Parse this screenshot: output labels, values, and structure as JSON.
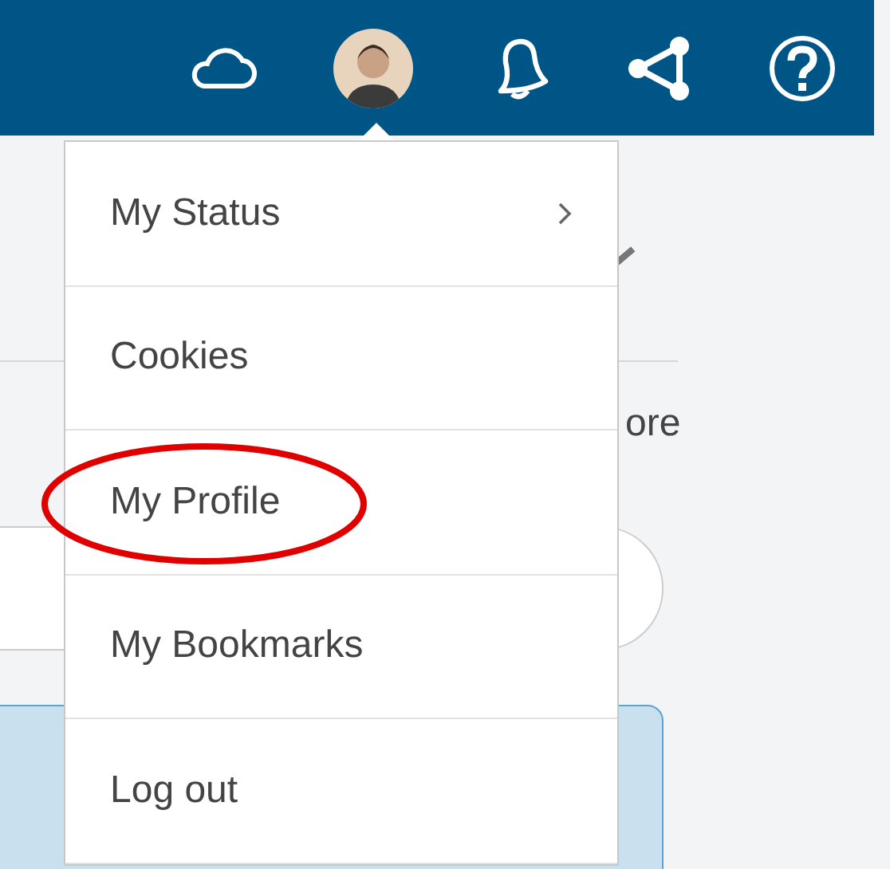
{
  "header": {
    "icons": [
      {
        "kind": "cloud"
      },
      {
        "kind": "avatar"
      },
      {
        "kind": "bell"
      },
      {
        "kind": "share"
      },
      {
        "kind": "help"
      }
    ]
  },
  "background": {
    "text": "ore"
  },
  "user_menu": {
    "items": [
      {
        "label": "My Status",
        "has_submenu": true,
        "circled": false
      },
      {
        "label": "Cookies",
        "has_submenu": false,
        "circled": false
      },
      {
        "label": "My Profile",
        "has_submenu": false,
        "circled": true
      },
      {
        "label": "My Bookmarks",
        "has_submenu": false,
        "circled": false
      },
      {
        "label": "Log out",
        "has_submenu": false,
        "circled": false
      }
    ]
  }
}
